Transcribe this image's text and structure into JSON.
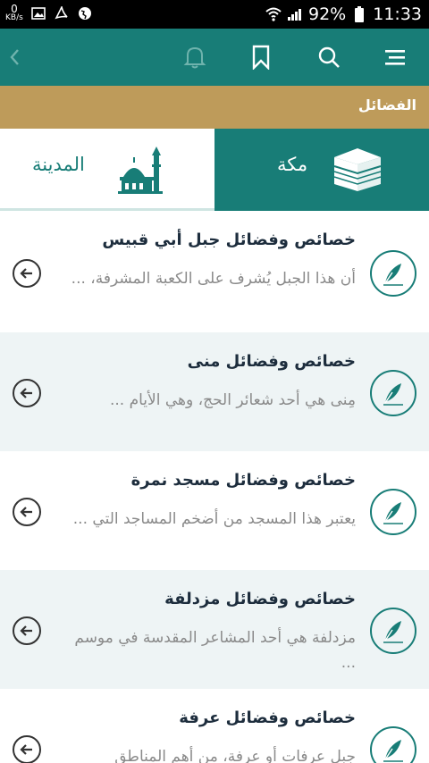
{
  "status_bar": {
    "kbs_value": "0",
    "kbs_unit": "KB/s",
    "battery": "92%",
    "time": "11:33"
  },
  "app_bar": {
    "icons": [
      "back-chevron-icon",
      "bell-icon",
      "bookmark-icon",
      "search-icon",
      "menu-icon"
    ]
  },
  "section": {
    "title": "الفضائل"
  },
  "tabs": {
    "madinah": {
      "label": "المدينة",
      "icon": "mosque-icon"
    },
    "makkah": {
      "label": "مكة",
      "icon": "kaaba-icon"
    }
  },
  "colors": {
    "primary": "#187d77",
    "gold": "#be9b5a",
    "alt_row": "#eef4f5"
  },
  "items": [
    {
      "title": "خصائص وفضائل جبل أبي قبيس",
      "snippet": "أن هذا الجبل يُشرف على الكعبة المشرفة، ..."
    },
    {
      "title": "خصائص وفضائل منى",
      "snippet": "مِنى هي أحد شعائر الحج، وهي الأيام ..."
    },
    {
      "title": "خصائص وفضائل مسجد نمرة",
      "snippet": "يعتبر هذا المسجد من أضخم المساجد التي ..."
    },
    {
      "title": "خصائص وفضائل مزدلفة",
      "snippet": "مزدلفة هي أحد المشاعر المقدسة في موسم ..."
    },
    {
      "title": "خصائص وفضائل عرفة",
      "snippet": "جبل عرفات أو عرفة، من أهم المناطق"
    }
  ]
}
